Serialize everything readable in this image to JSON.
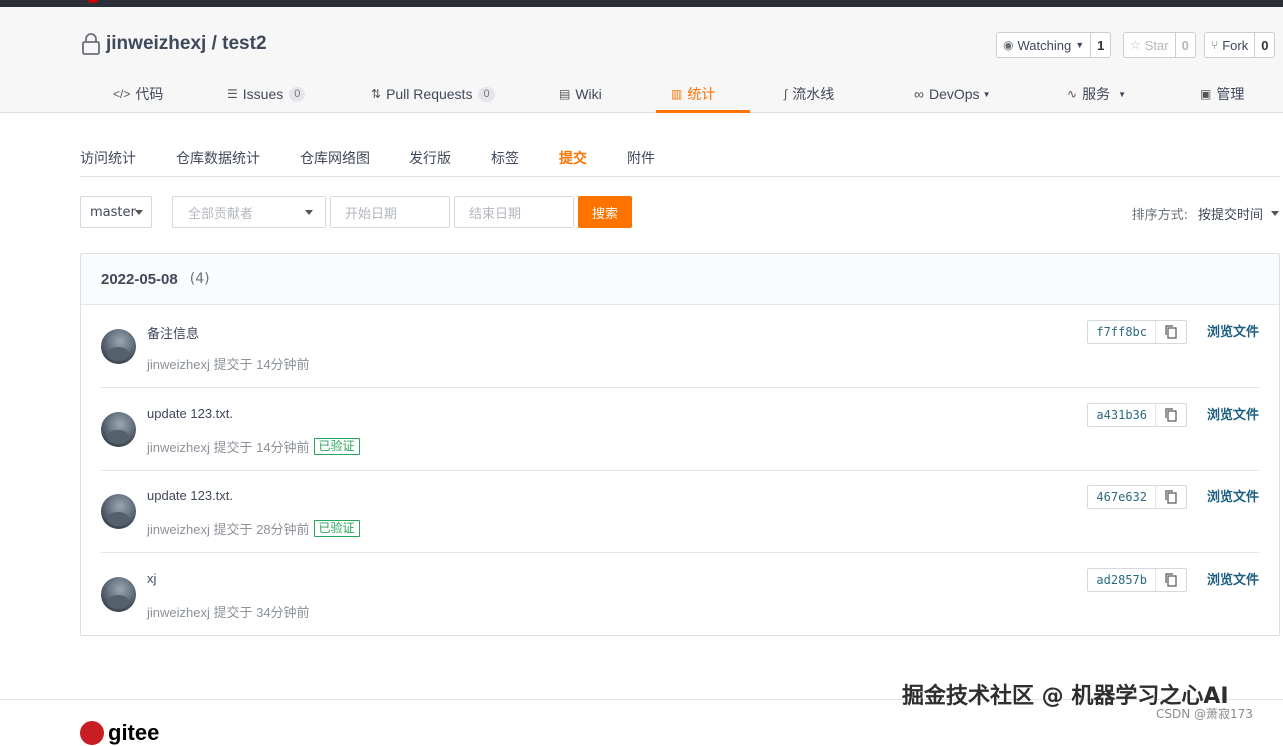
{
  "repo": {
    "owner": "jinweizhexj",
    "separator": " / ",
    "name": "test2"
  },
  "social": {
    "watch_label": "Watching",
    "watch_count": "1",
    "star_label": "Star",
    "star_count": "0",
    "fork_label": "Fork",
    "fork_count": "0"
  },
  "tabs": [
    {
      "icon": "code-icon",
      "label": "代码"
    },
    {
      "icon": "issues-icon",
      "label": "Issues",
      "badge": "0"
    },
    {
      "icon": "pull-request-icon",
      "label": "Pull Requests",
      "badge": "0"
    },
    {
      "icon": "wiki-icon",
      "label": "Wiki"
    },
    {
      "icon": "stats-icon",
      "label": "统计",
      "active": true
    },
    {
      "icon": "pipeline-icon",
      "label": "流水线"
    },
    {
      "icon": "devops-icon",
      "label": "DevOps"
    },
    {
      "icon": "service-icon",
      "label": "服务"
    },
    {
      "icon": "manage-icon",
      "label": "管理"
    }
  ],
  "subnav": [
    "访问统计",
    "仓库数据统计",
    "仓库网络图",
    "发行版",
    "标签",
    "提交",
    "附件"
  ],
  "subnav_active": "提交",
  "filters": {
    "branch": "master",
    "contributors_placeholder": "全部贡献者",
    "start_date_placeholder": "开始日期",
    "end_date_placeholder": "结束日期",
    "search_button": "搜索",
    "sort_label": "排序方式:",
    "sort_value": "按提交时间"
  },
  "commit_group": {
    "date": "2022-05-08",
    "count": "(4)"
  },
  "commits": [
    {
      "message": "备注信息",
      "meta": "jinweizhexj 提交于 14分钟前",
      "verified": "",
      "sha": "f7ff8bc",
      "browse": "浏览文件"
    },
    {
      "message": "update 123.txt.",
      "meta": "jinweizhexj 提交于 14分钟前",
      "verified": "已验证",
      "sha": "a431b36",
      "browse": "浏览文件"
    },
    {
      "message": "update 123.txt.",
      "meta": "jinweizhexj 提交于 28分钟前",
      "verified": "已验证",
      "sha": "467e632",
      "browse": "浏览文件"
    },
    {
      "message": "xj",
      "meta": "jinweizhexj 提交于 34分钟前",
      "verified": "",
      "sha": "ad2857b",
      "browse": "浏览文件"
    }
  ],
  "footer": {
    "logo_text": "gitee"
  },
  "watermark": {
    "main": "掘金技术社区 @ 机器学习之心AI",
    "sub": "CSDN @萧寂173"
  },
  "colors": {
    "accent": "#fe7300",
    "verified": "#27a55b",
    "sha_text": "#2c6a7e",
    "link": "#1b5e82"
  }
}
